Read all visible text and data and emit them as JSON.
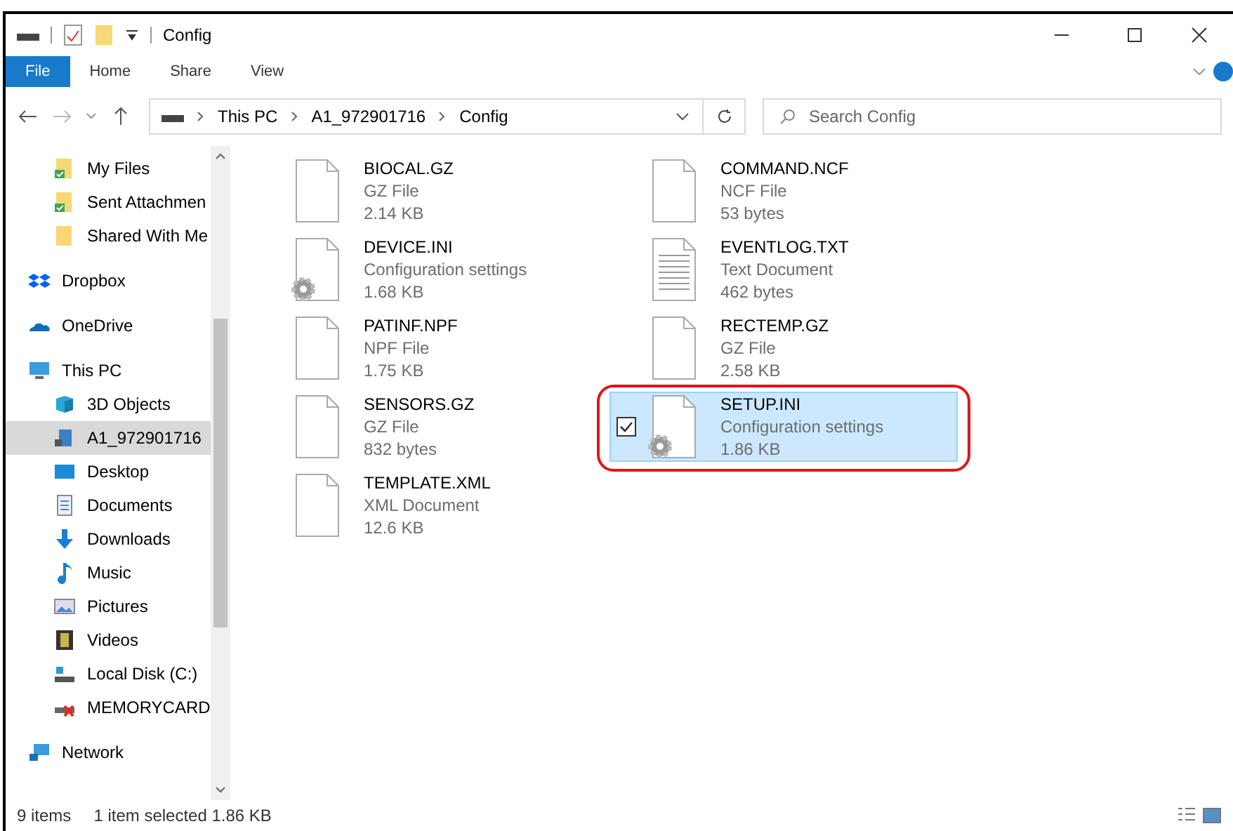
{
  "window": {
    "title": "Config"
  },
  "ribbon_tabs": [
    {
      "label": "File",
      "selected": true
    },
    {
      "label": "Home",
      "selected": false
    },
    {
      "label": "Share",
      "selected": false
    },
    {
      "label": "View",
      "selected": false
    }
  ],
  "address": {
    "crumbs": [
      "This PC",
      "A1_972901716",
      "Config"
    ]
  },
  "search": {
    "placeholder": "Search Config"
  },
  "sidebar": {
    "items": [
      {
        "children": [
          {
            "label": "My Files",
            "kind": "synced",
            "selected": false
          },
          {
            "label": "Sent Attachmen",
            "kind": "synced",
            "selected": false
          },
          {
            "label": "Shared With Me",
            "kind": "folder",
            "selected": false
          }
        ]
      },
      {
        "label": "Dropbox",
        "kind": "dropbox",
        "selected": false
      },
      {
        "label": "OneDrive",
        "kind": "cloud",
        "selected": false
      },
      {
        "label": "This PC",
        "kind": "pc",
        "selected": false,
        "children": [
          {
            "label": "3D Objects",
            "kind": "cube",
            "selected": false
          },
          {
            "label": "A1_972901716",
            "kind": "device",
            "selected": true
          },
          {
            "label": "Desktop",
            "kind": "desktop",
            "selected": false
          },
          {
            "label": "Documents",
            "kind": "document",
            "selected": false
          },
          {
            "label": "Downloads",
            "kind": "download",
            "selected": false
          },
          {
            "label": "Music",
            "kind": "music",
            "selected": false
          },
          {
            "label": "Pictures",
            "kind": "pictures",
            "selected": false
          },
          {
            "label": "Videos",
            "kind": "videos",
            "selected": false
          },
          {
            "label": "Local Disk (C:)",
            "kind": "disk",
            "selected": false
          },
          {
            "label": "MEMORYCARD",
            "kind": "card",
            "selected": false
          }
        ]
      },
      {
        "label": "Network",
        "kind": "network",
        "selected": false
      }
    ]
  },
  "files": [
    {
      "name": "BIOCAL.GZ",
      "type": "GZ File",
      "size": "2.14 KB",
      "kind": "blank",
      "selected": false,
      "circled": false
    },
    {
      "name": "COMMAND.NCF",
      "type": "NCF File",
      "size": "53 bytes",
      "kind": "blank",
      "selected": false,
      "circled": false
    },
    {
      "name": "DEVICE.INI",
      "type": "Configuration settings",
      "size": "1.68 KB",
      "kind": "config",
      "selected": false,
      "circled": false
    },
    {
      "name": "EVENTLOG.TXT",
      "type": "Text Document",
      "size": "462 bytes",
      "kind": "text",
      "selected": false,
      "circled": false
    },
    {
      "name": "PATINF.NPF",
      "type": "NPF File",
      "size": "1.75 KB",
      "kind": "blank",
      "selected": false,
      "circled": false
    },
    {
      "name": "RECTEMP.GZ",
      "type": "GZ File",
      "size": "2.58 KB",
      "kind": "blank",
      "selected": false,
      "circled": false
    },
    {
      "name": "SENSORS.GZ",
      "type": "GZ File",
      "size": "832 bytes",
      "kind": "blank",
      "selected": false,
      "circled": false
    },
    {
      "name": "SETUP.INI",
      "type": "Configuration settings",
      "size": "1.86 KB",
      "kind": "config",
      "selected": true,
      "circled": true
    },
    {
      "name": "TEMPLATE.XML",
      "type": "XML Document",
      "size": "12.6 KB",
      "kind": "blank",
      "selected": false,
      "circled": false
    }
  ],
  "status_bar": {
    "count": "9 items",
    "selection": "1 item selected 1.86 KB"
  }
}
